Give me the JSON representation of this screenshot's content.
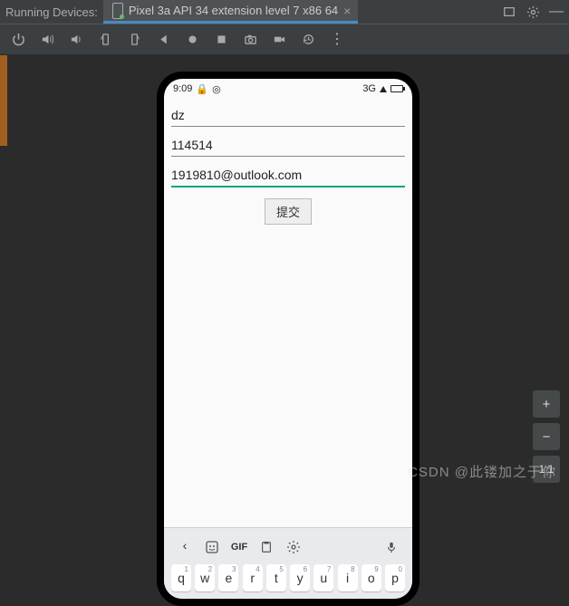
{
  "tabbar": {
    "label": "Running Devices:",
    "active_tab": "Pixel 3a API 34 extension level 7 x86 64"
  },
  "toolbar": {
    "icons": [
      "power",
      "volume-up",
      "volume-down",
      "rotate-left",
      "rotate-right",
      "back",
      "record",
      "stop",
      "camera",
      "video",
      "history",
      "more"
    ]
  },
  "device": {
    "status": {
      "time": "9:09",
      "net": "3G"
    },
    "form": {
      "field1": "dz",
      "field2": "114514",
      "field3": "1919810@outlook.com",
      "submit": "提交"
    },
    "keyboard": {
      "suggest": [
        "chevron-left",
        "sticker",
        "GIF",
        "clipboard",
        "settings",
        "mic"
      ],
      "row1": [
        {
          "k": "q",
          "s": "1"
        },
        {
          "k": "w",
          "s": "2"
        },
        {
          "k": "e",
          "s": "3"
        },
        {
          "k": "r",
          "s": "4"
        },
        {
          "k": "t",
          "s": "5"
        },
        {
          "k": "y",
          "s": "6"
        },
        {
          "k": "u",
          "s": "7"
        },
        {
          "k": "i",
          "s": "8"
        },
        {
          "k": "o",
          "s": "9"
        },
        {
          "k": "p",
          "s": "0"
        }
      ]
    }
  },
  "zoom": {
    "in": "+",
    "out": "−",
    "fit": "1:1"
  },
  "watermark": "CSDN @此镂加之于你"
}
